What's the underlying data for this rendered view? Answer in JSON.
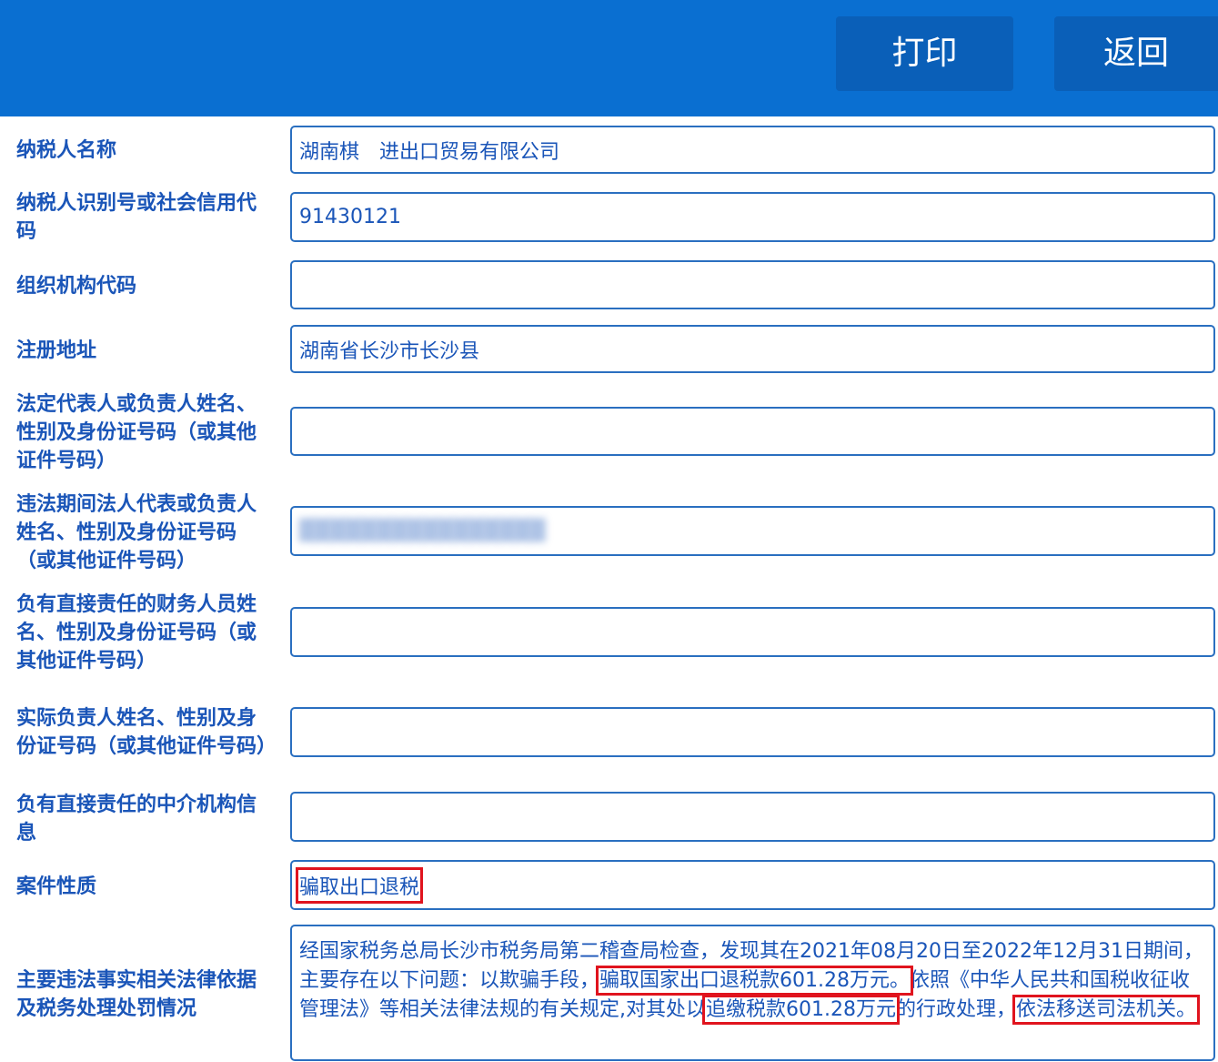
{
  "toolbar": {
    "print_label": "打印",
    "back_label": "返回"
  },
  "fields": [
    {
      "label": "纳税人名称",
      "value": "湖南棋　进出口贸易有限公司"
    },
    {
      "label": "纳税人识别号或社会信用代码",
      "value": "91430121"
    },
    {
      "label": "组织机构代码",
      "value": ""
    },
    {
      "label": "注册地址",
      "value": "湖南省长沙市长沙县"
    },
    {
      "label": "法定代表人或负责人姓名、性别及身份证号码（或其他证件号码）",
      "value": ""
    },
    {
      "label": "违法期间法人代表或负责人姓名、性别及身份证号码（或其他证件号码）",
      "value": ""
    },
    {
      "label": "负有直接责任的财务人员姓名、性别及身份证号码（或其他证件号码）",
      "value": ""
    },
    {
      "label": "实际负责人姓名、性别及身份证号码（或其他证件号码）",
      "value": ""
    },
    {
      "label": "负有直接责任的中介机构信息",
      "value": ""
    },
    {
      "label": "案件性质",
      "value": "骗取出口退税"
    },
    {
      "label": "主要违法事实相关法律依据及税务处理处罚情况",
      "value_parts": [
        "经国家税务总局长沙市税务局第二稽查局检查，发现其在2021年08月20日至2022年12月31日期间，主要存在以下问题：以欺骗手段，",
        "骗取国家出口退税款601.28万元。",
        "依照《中华人民共和国税收征收管理法》等相关法律法规的有关规定,对其处以",
        "追缴税款601.28万元",
        "的行政处理，",
        "依法移送司法机关。"
      ]
    }
  ]
}
